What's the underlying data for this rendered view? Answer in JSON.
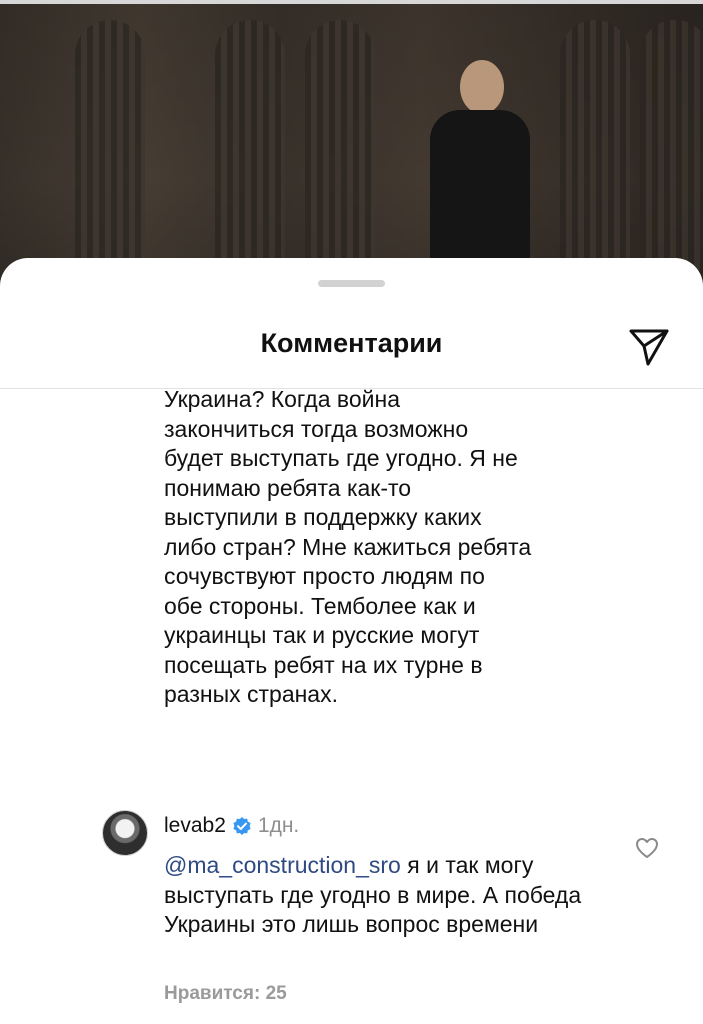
{
  "sheet": {
    "title": "Комментарии",
    "share_icon": "paper-plane-icon"
  },
  "comment_continuation": {
    "text": "Украина?  Когда война\nзакончиться тогда возможно\nбудет выступать где угодно.  Я не\nпонимаю ребята как-то\nвыступили в поддержку каких\nлибо стран? Мне кажиться ребята\nсочувствуют просто людям по\nобе стороны. Темболее как и\nукраинцы так и русские могут\nпосещать ребят на их турне в\nразных странах."
  },
  "reply": {
    "username": "levab2",
    "verified_icon": "verified-badge-icon",
    "time": "1дн.",
    "mention": "@ma_construction_sro",
    "text": " я и так могу выступать где угодно в мире. А победа Украины это лишь вопрос времени",
    "likes": "Нравится: 25",
    "like_icon": "heart-outline-icon"
  },
  "colors": {
    "mention": "#2f4a83",
    "verified": "#3897f0",
    "secondary_text": "#8e8e8e"
  }
}
